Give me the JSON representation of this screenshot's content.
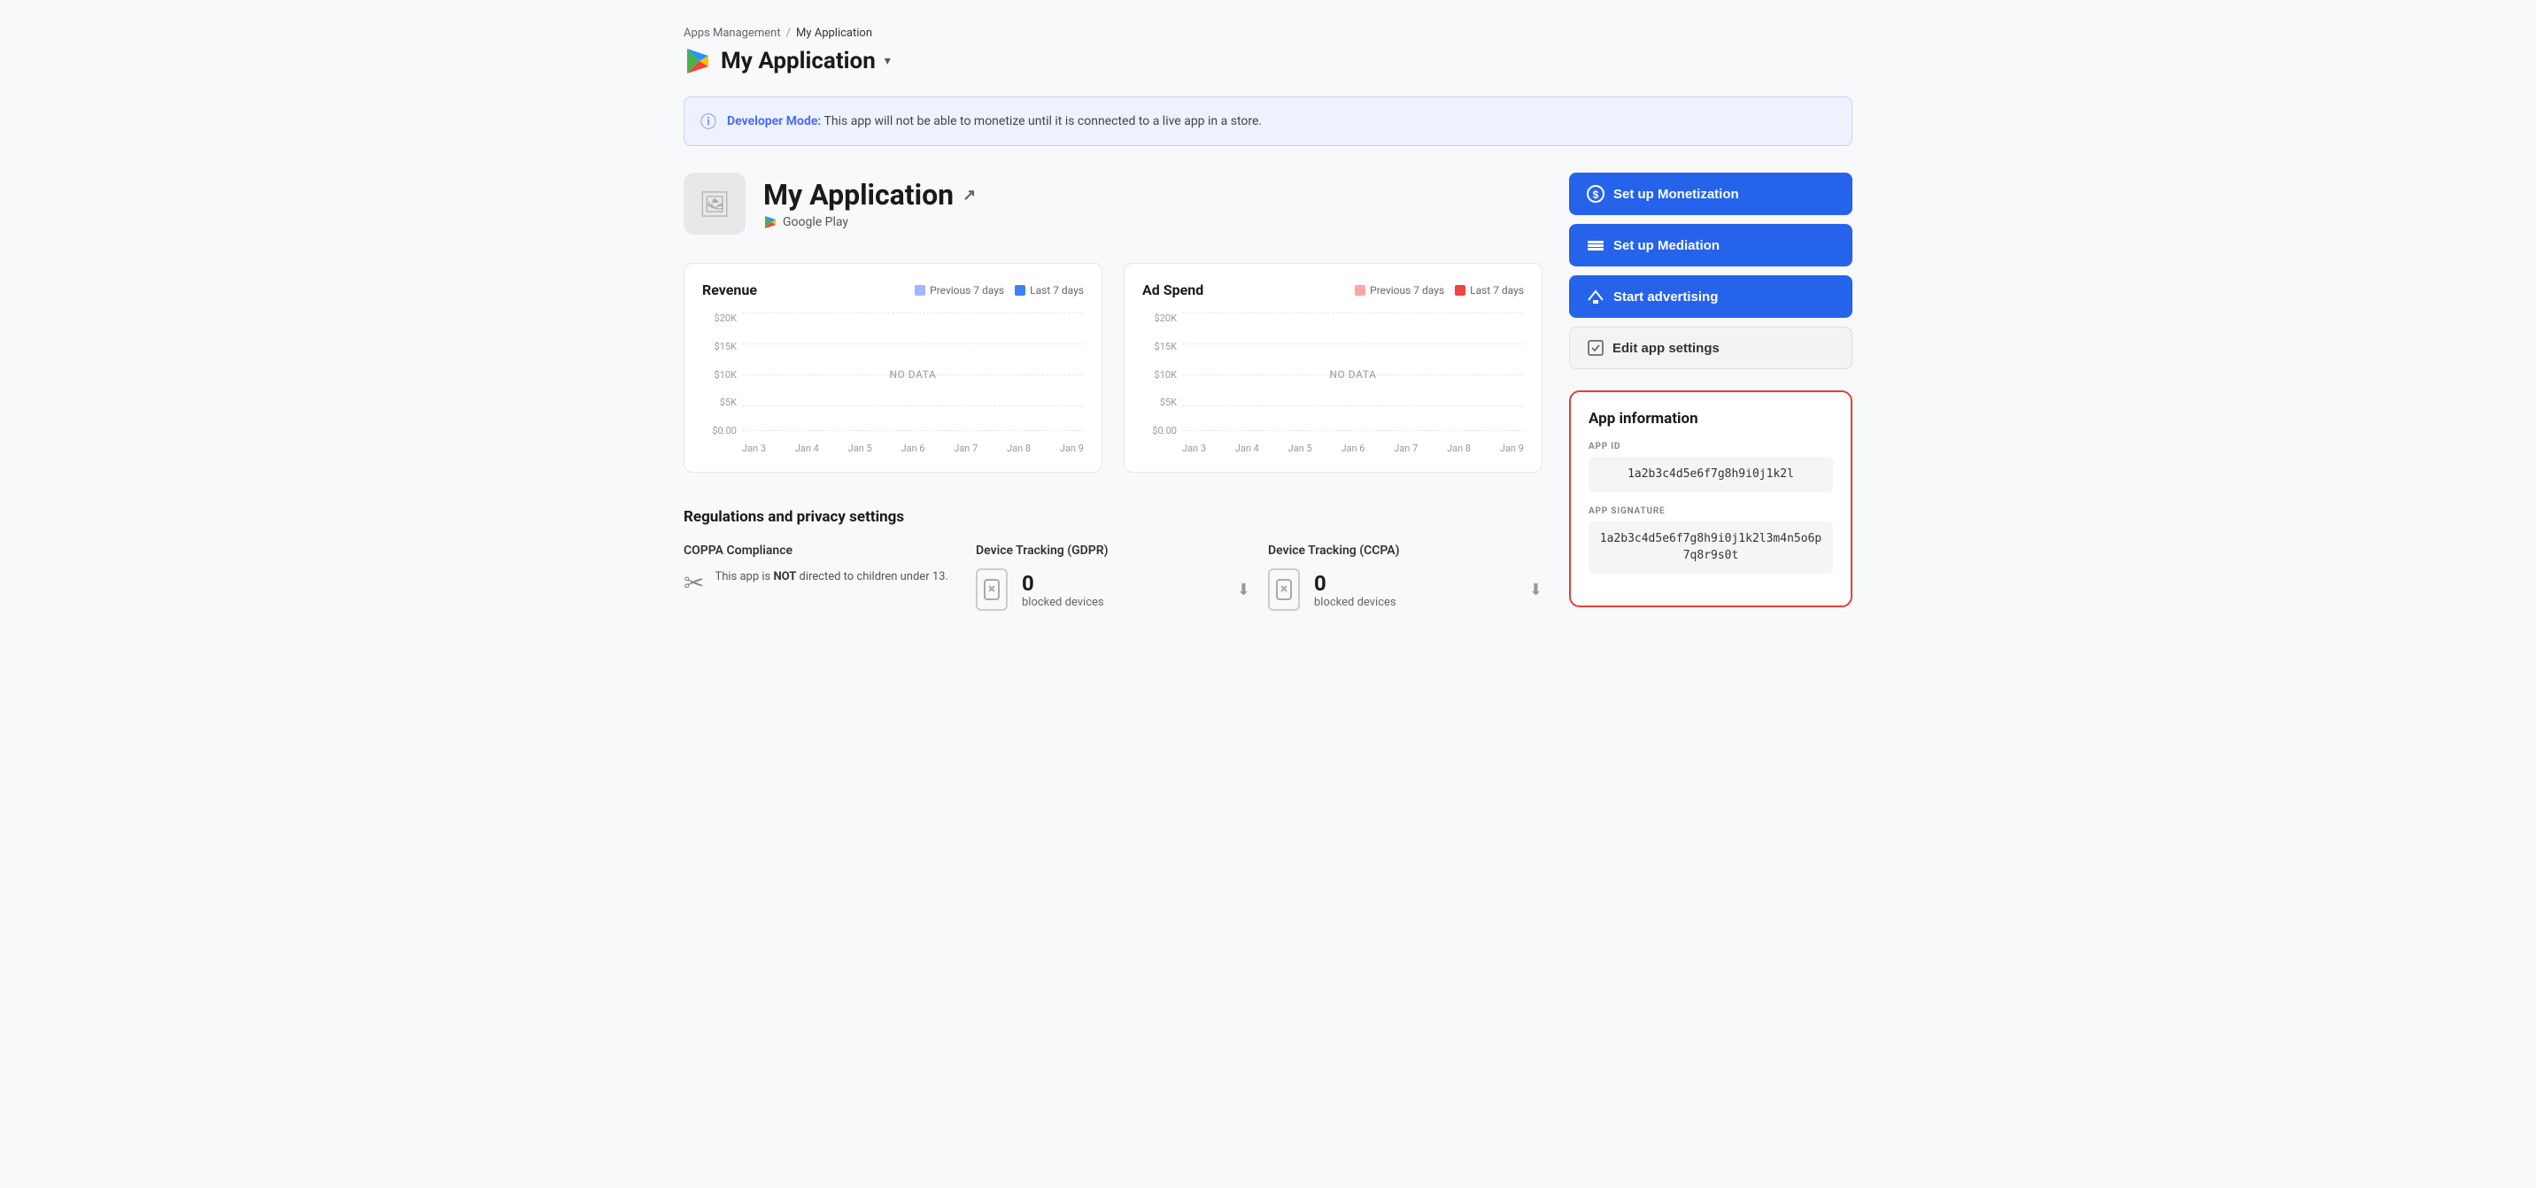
{
  "breadcrumb": {
    "parent": "Apps Management",
    "separator": "/",
    "current": "My Application"
  },
  "page_title": "My Application",
  "dev_banner": {
    "label": "Developer Mode:",
    "message": " This app will not be able to monetize until it is connected to a live app in a store."
  },
  "app": {
    "name": "My Application",
    "platform": "Google Play"
  },
  "revenue_chart": {
    "title": "Revenue",
    "legend": [
      {
        "label": "Previous 7 days",
        "color": "#a5b4fc"
      },
      {
        "label": "Last 7 days",
        "color": "#3b82f6"
      }
    ],
    "y_labels": [
      "$20K",
      "$15K",
      "$10K",
      "$5K",
      "$0.00"
    ],
    "x_labels": [
      "Jan 3",
      "Jan 4",
      "Jan 5",
      "Jan 6",
      "Jan 7",
      "Jan 8",
      "Jan 9"
    ],
    "no_data": "NO DATA"
  },
  "adspend_chart": {
    "title": "Ad Spend",
    "legend": [
      {
        "label": "Previous 7 days",
        "color": "#fca5a5"
      },
      {
        "label": "Last 7 days",
        "color": "#ef4444"
      }
    ],
    "y_labels": [
      "$20K",
      "$15K",
      "$10K",
      "$5K",
      "$0.00"
    ],
    "x_labels": [
      "Jan 3",
      "Jan 4",
      "Jan 5",
      "Jan 6",
      "Jan 7",
      "Jan 8",
      "Jan 9"
    ],
    "no_data": "NO DATA"
  },
  "buttons": {
    "monetization": "Set up Monetization",
    "mediation": "Set up Mediation",
    "advertising": "Start advertising",
    "edit_settings": "Edit app settings"
  },
  "app_info": {
    "title": "App information",
    "app_id_label": "APP ID",
    "app_id_value": "1a2b3c4d5e6f7g8h9i0j1k2l",
    "app_signature_label": "APP SIGNATURE",
    "app_signature_value": "1a2b3c4d5e6f7g8h9i0j1k2l3m4n5o6p7q8r9s0t"
  },
  "regulations": {
    "title": "Regulations and privacy settings",
    "coppa": {
      "title": "COPPA Compliance",
      "text_before": "This app is ",
      "text_bold": "NOT",
      "text_after": " directed to children under 13."
    },
    "gdpr": {
      "title": "Device Tracking (GDPR)",
      "count": "0",
      "label": "blocked devices"
    },
    "ccpa": {
      "title": "Device Tracking (CCPA)",
      "count": "0",
      "label": "blocked devices"
    }
  }
}
